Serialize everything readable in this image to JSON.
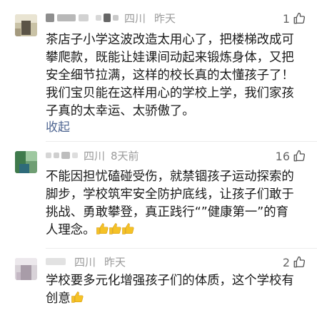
{
  "comments": [
    {
      "location": "四川",
      "time": "昨天",
      "likes": "1",
      "lines": [
        "茶店子小学这波改造太用心了，把楼梯改成可",
        "攀爬款，既能让娃课间动起来锻炼身体，又把",
        "安全细节拉满，这样的校长真的太懂孩子了！",
        "我们宝贝能在这样用心的学校上学，我们家孩",
        "子真的太幸运、太骄傲了。"
      ],
      "collapse": "收起"
    },
    {
      "location": "四川",
      "time": "8天前",
      "likes": "16",
      "lines": [
        "不能因担忧磕碰受伤，就禁锢孩子运动探索的",
        "脚步，学校筑牢安全防护底线，让孩子们敢于",
        "挑战、勇敢攀登，真正践行“”健康第一”的育",
        "人理念。"
      ]
    },
    {
      "location": "四川",
      "time": "昨天",
      "likes": "2",
      "lines": [
        "学校要多元化增强孩子们的体质，这个学校有",
        "创意"
      ]
    }
  ],
  "icons": {
    "like": "thumbs-up-outline-icon",
    "emoji": "thumbs-up-emoji-icon"
  },
  "colors": {
    "meta": "#9a9a9a",
    "collapse": "#4f6692",
    "emoji": "#f5c226"
  }
}
